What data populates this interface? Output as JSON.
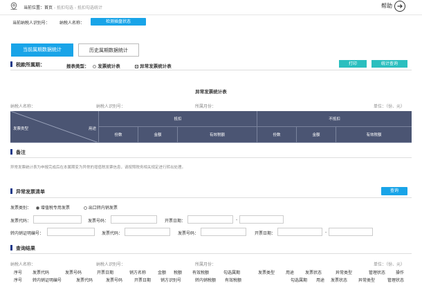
{
  "header": {
    "location_label": "当前位置：",
    "location_home": "首页",
    "location_path": " - 抵扣勾选 - 抵扣勾选统计",
    "help_label": "帮助"
  },
  "taxpayer": {
    "id_label": "当前纳税人识别号：",
    "name_label": "纳税人名称：",
    "check_btn": "检测插盘状态"
  },
  "tabs": [
    {
      "label": "当前属期数据统计",
      "active": true
    },
    {
      "label": "历史属期数据统计",
      "active": false
    }
  ],
  "filter": {
    "period_label": "税款所属期：",
    "report_type_label": "报表类型：",
    "option1": "发票统计表",
    "option2": "异常发票统计表",
    "print_btn": "打印",
    "query_btn": "统计查询"
  },
  "report": {
    "title": "异常发票统计表",
    "taxpayer_name": "纳税人名称：",
    "taxpayer_id": "纳税人识别号：",
    "period": "所属月份：",
    "unit": "单位：（份、元）",
    "corner_left": "发票类型",
    "corner_right": "用途",
    "group1": "抵扣",
    "group2": "不抵扣",
    "cols": [
      "份数",
      "金额",
      "有效税额",
      "份数",
      "金额",
      "有效税额"
    ]
  },
  "remark": {
    "title": "备注",
    "text": "异常发票统计表为申报完成后在本属期变为异常的增值税发票信息，请按照税务相关规定进行转出处理。"
  },
  "abnormal": {
    "title": "异常发票清单",
    "query_btn": "查询",
    "invoice_type_label": "发票类别：",
    "type1": "增值税专用发票",
    "type2": "出口转内销发票",
    "code_label": "发票代码：",
    "number_label": "发票号码：",
    "date_label": "开票日期：",
    "dash": "-",
    "transfer_no_label": "转内销证明编号：",
    "code2_label": "发票代码：",
    "number2_label": "发票号码：",
    "date2_label": "开票日期：",
    "dash2": "-"
  },
  "results": {
    "title": "查询结果",
    "taxpayer_name": "纳税人名称：",
    "taxpayer_id": "纳税人识别号：",
    "period": "所属月份：",
    "unit": "单位：（份、元）",
    "header1": [
      "序号",
      "发票代码",
      "发票号码",
      "开票日期",
      "销方名称",
      "金额",
      "税额",
      "有效税额",
      "勾选属期",
      "发票类型",
      "用途",
      "发票状态",
      "异常类型",
      "管理状态",
      "操作"
    ],
    "header2": [
      "序号",
      "转内销证明编号",
      "发票代码",
      "发票号码",
      "开票日期",
      "销方识别号",
      "转内销税额",
      "有效税额",
      "勾选属期",
      "用途",
      "发票状态",
      "异常类型",
      "管理状态"
    ]
  }
}
